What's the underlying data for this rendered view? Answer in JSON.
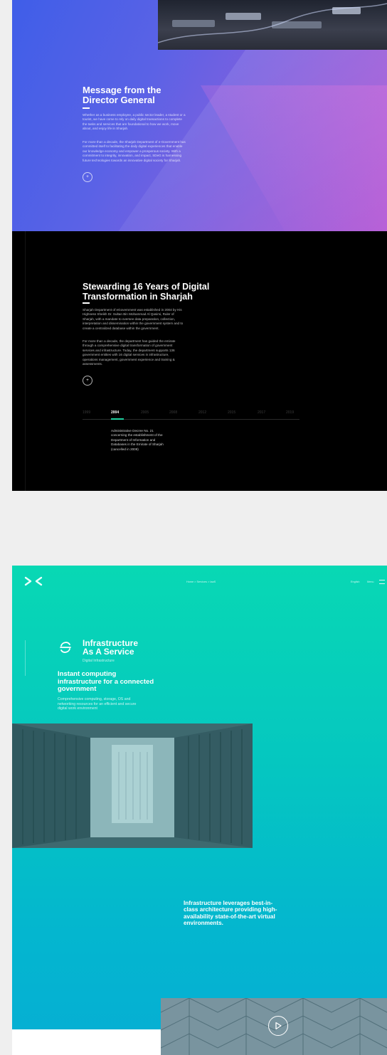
{
  "director": {
    "title_line1": "Message from the",
    "title_line2": "Director General",
    "para1_lines": [
      "Whether as a business employee, a public sector leader, a student or a",
      "tourist, we have come to rely on daily digital transactions to complete",
      "the tasks and services that are foundational to how we work, move",
      "about, and enjoy life in Sharjah."
    ],
    "para2_lines": [
      "For more than a decade, the Sharjah Department of e-Government has",
      "committed itself to facilitating the daily digital experiences that enable",
      "our knowledge economy and empower a prosperous society. With a",
      "commitment to integrity, innovation, and impact, SDeG is harnessing",
      "future technologies towards an innovative digital society for Sharjah."
    ],
    "button_icon": "plus-icon"
  },
  "history": {
    "title_line1": "Stewarding 16 Years of Digital",
    "title_line2": "Transformation in Sharjah",
    "para1_lines": [
      "Sharjah Department of eGovernment was established in 2004 by His",
      "Highness Sheikh Dr. Sultan Bin Mohammad Al Qasimi, Ruler of",
      "Sharjah, with a mandate to oversee data preparation, collection,",
      "interpretation and dissemination within the government system and to",
      "create a centralized database within the government."
    ],
    "para2_lines": [
      "For more than a decade, the department has guided the emirate",
      "through a comprehensive digital transformation of government",
      "services and infrastructure. Today, the department supports 136",
      "government entities with 16 digital services in infrastructure,",
      "operations management, government experience and training &",
      "assessments."
    ],
    "button_icon": "plus-icon",
    "timeline": {
      "years": [
        "1999",
        "2004",
        "2005",
        "2008",
        "2012",
        "2015",
        "2017",
        "2019"
      ],
      "active_year": "2004",
      "active_lines": [
        "Administrative Decree No. 21",
        "concerning the establishment of the",
        "Department of Information and",
        "Databases in the Emirate of Sharjah",
        "(cancelled in 2009)"
      ]
    }
  },
  "iaas": {
    "logo_icon": "chevrons-logo-icon",
    "breadcrumb": "Home  >  Services  >  IaaS",
    "language": "English",
    "menu_label": "Menu",
    "service_icon": "cycle-icon",
    "service_title_line1": "Infrastructure",
    "service_title_line2": "As A Service",
    "category": "Digital Infrastructure",
    "headline_line1": "Instant computing",
    "headline_line2": "infrastructure for a connected",
    "headline_line3": "government",
    "desc_lines": [
      "Comprehensive computing, storage, OS and",
      "networking resources for an efficient and secure",
      "digital work environment"
    ],
    "feature_lines": [
      "Infrastructure leverages best-in-",
      "class architecture providing high-",
      "availability state-of-the-art virtual",
      "environments."
    ],
    "play_icon": "play-icon"
  },
  "colors": {
    "purple_gradient_start": "#3f5ee8",
    "purple_gradient_end": "#b25cd6",
    "accent_green": "#1fd1a0",
    "teal_start": "#08d8b4",
    "teal_end": "#06aed4"
  }
}
